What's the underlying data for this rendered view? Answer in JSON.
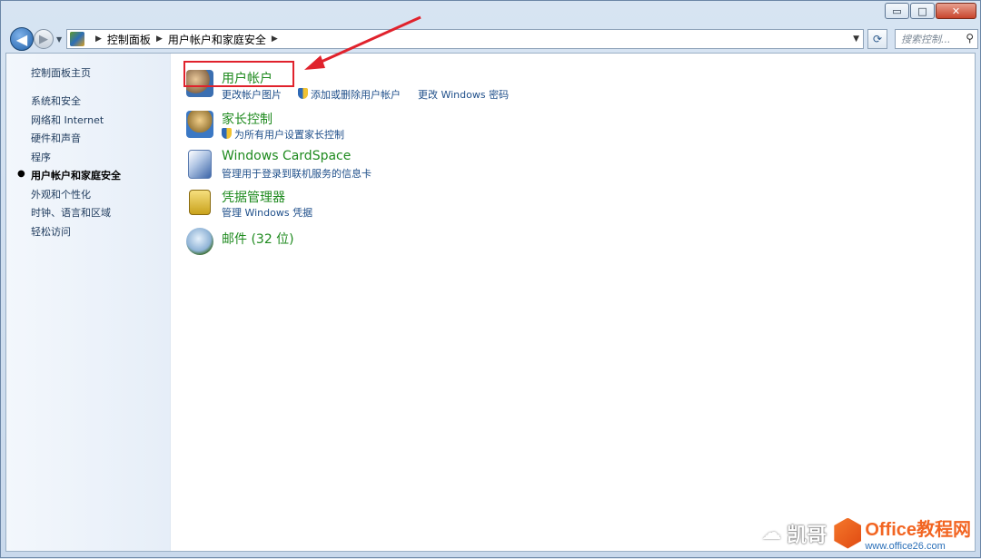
{
  "titlebar": {
    "minimize_glyph": "▭",
    "maximize_glyph": "□",
    "close_glyph": "✕"
  },
  "address_bar": {
    "crumbs": [
      "控制面板",
      "用户帐户和家庭安全"
    ]
  },
  "search": {
    "placeholder": "搜索控制..."
  },
  "sidebar": {
    "home": "控制面板主页",
    "items": [
      "系统和安全",
      "网络和 Internet",
      "硬件和声音",
      "程序",
      "用户帐户和家庭安全",
      "外观和个性化",
      "时钟、语言和区域",
      "轻松访问"
    ],
    "current_index": 4
  },
  "categories": [
    {
      "title": "用户帐户",
      "icon": "users-icon",
      "links": [
        "更改帐户图片",
        "添加或删除用户帐户",
        "更改 Windows 密码"
      ]
    },
    {
      "title": "家长控制",
      "icon": "parental-controls-icon",
      "links": [
        "为所有用户设置家长控制"
      ]
    },
    {
      "title": "Windows CardSpace",
      "icon": "cardspace-icon",
      "links": [
        "管理用于登录到联机服务的信息卡"
      ]
    },
    {
      "title": "凭据管理器",
      "icon": "credential-manager-icon",
      "links": [
        "管理 Windows 凭据"
      ]
    },
    {
      "title": "邮件 (32 位)",
      "icon": "mail-icon",
      "links": []
    }
  ],
  "watermark": {
    "name": "凯哥",
    "brand": "Office教程网",
    "url": "www.office26.com"
  },
  "colors": {
    "category_green": "#1e8a1e",
    "link_blue": "#1f4f8a",
    "annotation_red": "#e0222c"
  }
}
